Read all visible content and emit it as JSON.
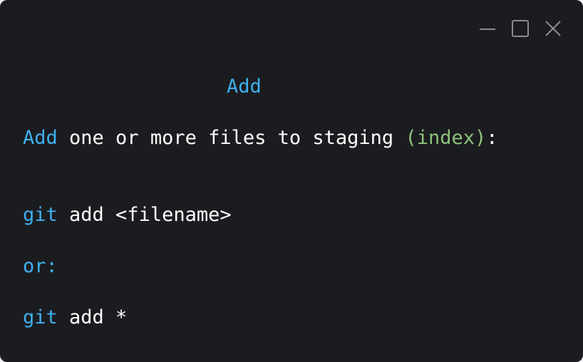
{
  "window": {
    "controls": {
      "minimize": "minimize-icon",
      "maximize": "maximize-icon",
      "close": "close-icon"
    }
  },
  "content": {
    "title": "Add",
    "description": {
      "keyword": "Add",
      "text": " one or more files to staging ",
      "paren": "(index)",
      "colon": ":"
    },
    "command1": {
      "cmd": "git",
      "args": " add <filename>"
    },
    "or_label": "or:",
    "command2": {
      "cmd": "git",
      "args": " add *"
    }
  },
  "colors": {
    "background": "#1b1c1f",
    "keyword": "#3fb0f0",
    "string": "#8fc27d",
    "text": "#ffffff"
  }
}
